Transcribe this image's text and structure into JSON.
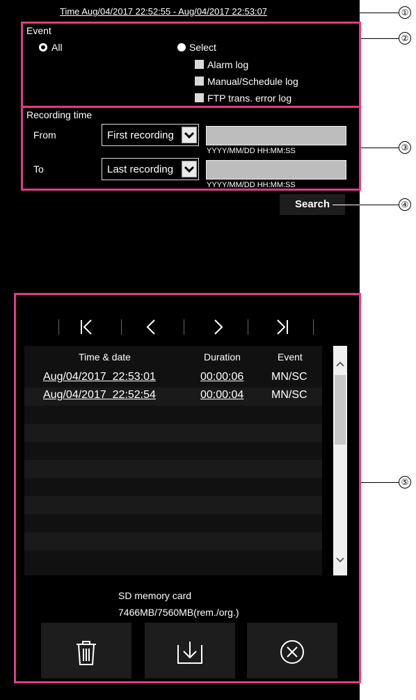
{
  "header": {
    "time_range": "Time Aug/04/2017 22:52:55 - Aug/04/2017 22:53:07"
  },
  "event": {
    "title": "Event",
    "all_label": "All",
    "select_label": "Select",
    "checkboxes": [
      "Alarm log",
      "Manual/Schedule log",
      "FTP trans. error log"
    ]
  },
  "recording": {
    "title": "Recording time",
    "from_label": "From",
    "from_value": "First recording",
    "to_label": "To",
    "to_value": "Last recording",
    "format_hint": "YYYY/MM/DD HH:MM:SS"
  },
  "search_label": "Search",
  "table": {
    "headers": [
      "Time & date",
      "Duration",
      "Event"
    ],
    "rows": [
      {
        "time": "Aug/04/2017  22:53:01",
        "duration": "00:00:06",
        "event": "MN/SC"
      },
      {
        "time": "Aug/04/2017  22:52:54",
        "duration": "00:00:04",
        "event": "MN/SC"
      }
    ]
  },
  "storage": {
    "name": "SD memory card",
    "capacity": "7466MB/7560MB(rem./org.)"
  },
  "callouts": [
    "①",
    "②",
    "③",
    "④",
    "⑤"
  ]
}
